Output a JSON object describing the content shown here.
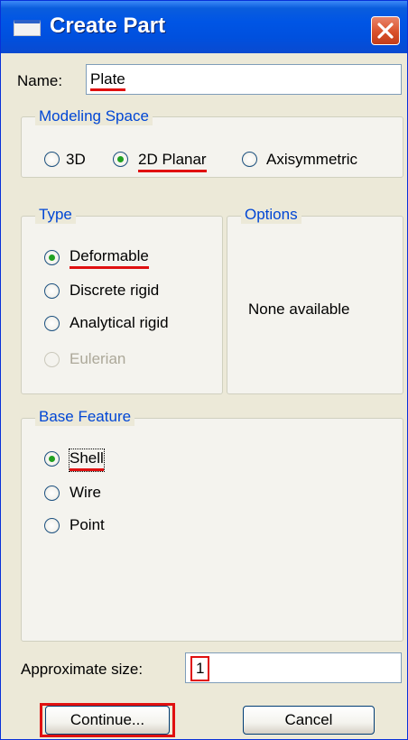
{
  "window": {
    "title": "Create Part"
  },
  "name": {
    "label": "Name:",
    "value": "Plate"
  },
  "modeling_space": {
    "legend": "Modeling Space",
    "options": [
      "3D",
      "2D Planar",
      "Axisymmetric"
    ],
    "selected": "2D Planar"
  },
  "type": {
    "legend": "Type",
    "options": [
      "Deformable",
      "Discrete rigid",
      "Analytical rigid",
      "Eulerian"
    ],
    "selected": "Deformable",
    "disabled": [
      "Eulerian"
    ]
  },
  "options_panel": {
    "legend": "Options",
    "text": "None available"
  },
  "base_feature": {
    "legend": "Base Feature",
    "options": [
      "Shell",
      "Wire",
      "Point"
    ],
    "selected": "Shell"
  },
  "approx_size": {
    "label": "Approximate size:",
    "value": "1"
  },
  "buttons": {
    "continue": "Continue...",
    "cancel": "Cancel"
  },
  "colors": {
    "title_bar": "#0055e5",
    "legend_text": "#0046d5",
    "highlight": "#e01010",
    "radio_checked": "#21a121"
  }
}
